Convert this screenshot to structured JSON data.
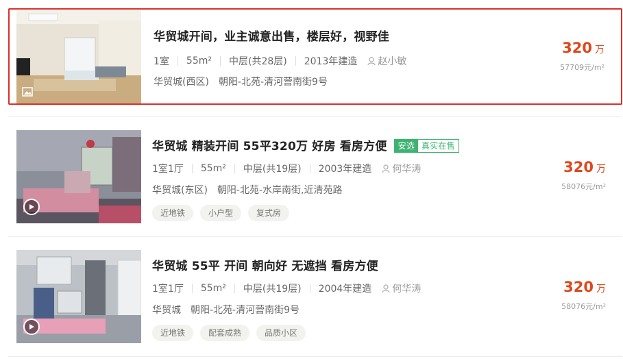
{
  "listings": [
    {
      "title": "华贸城开间，业主诚意出售，楼层好，视野佳",
      "badges": null,
      "layout": "1室",
      "area": "55m²",
      "floor": "中层(共28层)",
      "built": "2013年建造",
      "agent": "赵小敏",
      "community": "华贸城(西区)",
      "location": "朝阳-北苑-清河营南街9号",
      "tags": [],
      "price": "320",
      "price_unit": "万",
      "unit_price": "57709元/m²",
      "media_icon": "image-icon",
      "highlighted": true
    },
    {
      "title": "华贸城 精装开间 55平320万 好房 看房方便",
      "badges": {
        "a": "安选",
        "b": "真实在售"
      },
      "layout": "1室1厅",
      "area": "55m²",
      "floor": "中层(共19层)",
      "built": "2003年建造",
      "agent": "何华涛",
      "community": "华贸城(东区)",
      "location": "朝阳-北苑-水岸南街,近清苑路",
      "tags": [
        "近地铁",
        "小户型",
        "复式房"
      ],
      "price": "320",
      "price_unit": "万",
      "unit_price": "58076元/m²",
      "media_icon": "play-icon",
      "highlighted": false
    },
    {
      "title": "华贸城 55平 开间 朝向好 无遮挡 看房方便",
      "badges": null,
      "layout": "1室1厅",
      "area": "55m²",
      "floor": "中层(共19层)",
      "built": "2004年建造",
      "agent": "何华涛",
      "community": "华贸城",
      "location": "朝阳-北苑-清河营南街9号",
      "tags": [
        "近地铁",
        "配套成熟",
        "品质小区"
      ],
      "price": "320",
      "price_unit": "万",
      "unit_price": "58076元/m²",
      "media_icon": "play-icon",
      "highlighted": false
    }
  ],
  "colors": {
    "highlight_border": "#d9302a",
    "price": "#e0471b",
    "badge_green": "#3cb371"
  }
}
